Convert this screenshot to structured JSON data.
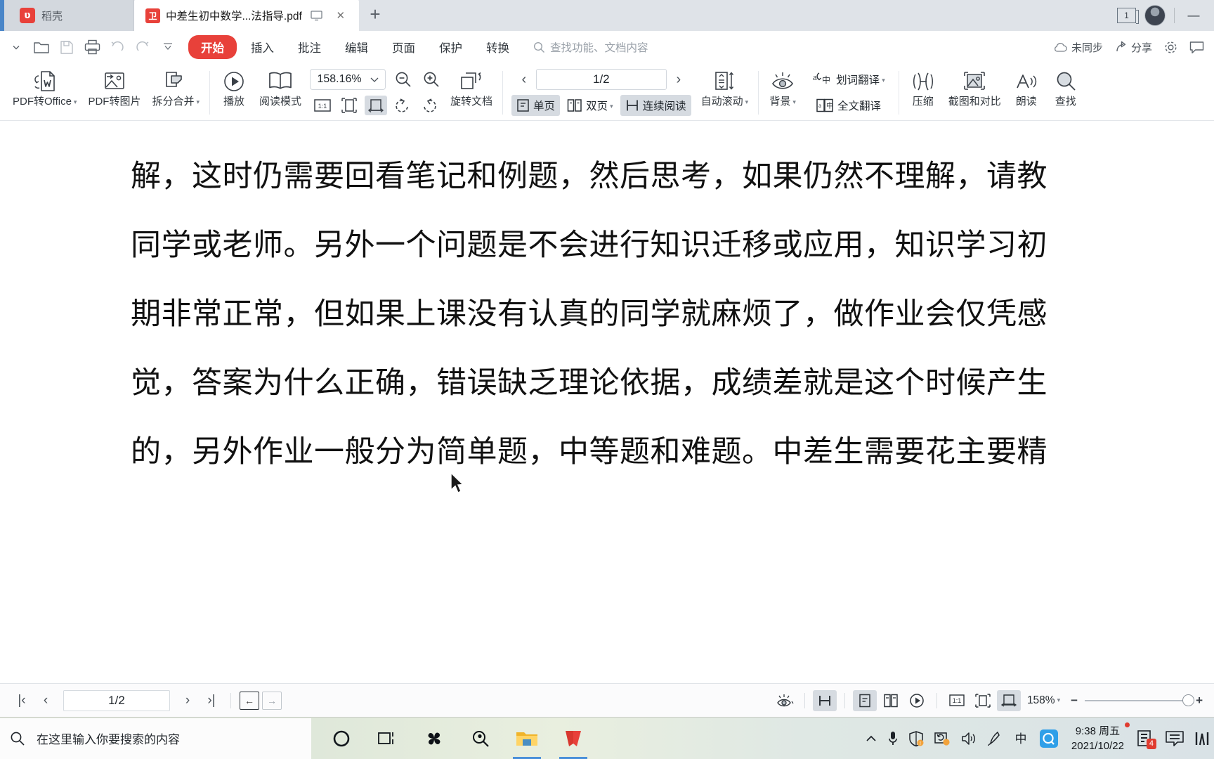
{
  "tabbar": {
    "docer_label": "稻壳",
    "docer_logo_glyph": "ʋ",
    "doc_tab_title": "中差生初中数学...法指导.pdf",
    "pdf_badge_glyph": "卫",
    "new_tab_glyph": "+",
    "close_glyph": "✕",
    "window_count": "1",
    "minimize_glyph": "—"
  },
  "menubar": {
    "quick_access": [
      {
        "name": "dropdown-more",
        "glyph": "⌄"
      },
      {
        "name": "open-file",
        "glyph": "open"
      },
      {
        "name": "save-file",
        "glyph": "save"
      },
      {
        "name": "print",
        "glyph": "print"
      },
      {
        "name": "undo",
        "glyph": "↺"
      },
      {
        "name": "redo",
        "glyph": "↻"
      },
      {
        "name": "customize",
        "glyph": "⌄"
      }
    ],
    "menus": [
      {
        "label": "开始",
        "active": true
      },
      {
        "label": "插入",
        "active": false
      },
      {
        "label": "批注",
        "active": false
      },
      {
        "label": "编辑",
        "active": false
      },
      {
        "label": "页面",
        "active": false
      },
      {
        "label": "保护",
        "active": false
      },
      {
        "label": "转换",
        "active": false
      }
    ],
    "search_placeholder": "查找功能、文档内容",
    "sync_status": "未同步",
    "share_label": "分享",
    "settings_icon": "gear-icon",
    "feedback_icon": "feedback-icon"
  },
  "ribbon": {
    "pdf_to_office": "PDF转Office",
    "pdf_to_image": "PDF转图片",
    "split_merge": "拆分合并",
    "play": "播放",
    "read_mode": "阅读模式",
    "zoom_value": "158.16%",
    "zoom_out_icon": "zoom-out-icon",
    "zoom_in_icon": "zoom-in-icon",
    "fit_actual": "1:1",
    "fit_page_icon": "fit-page-icon",
    "fit_width_icon": "fit-width-icon",
    "rotate_left_icon": "rotate-left-icon",
    "rotate_right_icon": "rotate-right-icon",
    "rotate_doc": "旋转文档",
    "page_indicator": "1/2",
    "prev_page_glyph": "‹",
    "next_page_glyph": "›",
    "single_page": "单页",
    "double_page": "双页",
    "continuous_read": "连续阅读",
    "auto_scroll": "自动滚动",
    "background": "背景",
    "word_translate": "划词翻译",
    "full_translate": "全文翻译",
    "compress": "压缩",
    "screenshot_compare": "截图和对比",
    "read_aloud": "朗读",
    "find": "查找"
  },
  "document": {
    "lines": [
      "解，这时仍需要回看笔记和例题，然后思考，如果仍然不理解，请教",
      "同学或老师。另外一个问题是不会进行知识迁移或应用，知识学习初",
      "期非常正常，但如果上课没有认真的同学就麻烦了，做作业会仅凭感",
      "觉，答案为什么正确，错误缺乏理论依据，成绩差就是这个时候产生",
      "的，另外作业一般分为简单题，中等题和难题。中差生需要花主要精"
    ]
  },
  "statusbar": {
    "first_page_glyph": "|‹",
    "prev_page_glyph": "‹",
    "page_indicator": "1/2",
    "next_page_glyph": "›",
    "last_page_glyph": "›|",
    "back_glyph": "←",
    "forward_glyph": "→",
    "eye_protect_icon": "eye-protect-icon",
    "continuous_icon": "continuous-read-icon",
    "single_page_icon": "single-page-icon",
    "double_page_icon": "double-page-icon",
    "play_icon": "play-icon",
    "actual_size": "1:1",
    "fit_page_icon": "fit-page-icon",
    "fit_width_icon": "fit-width-icon",
    "zoom_text": "158%",
    "zoom_caret": "▾",
    "minus_glyph": "−",
    "plus_glyph": "+"
  },
  "taskbar": {
    "search_placeholder": "在这里输入你要搜索的内容",
    "search_icon": "search-icon",
    "apps": [
      {
        "name": "cortana-icon"
      },
      {
        "name": "task-view-icon"
      },
      {
        "name": "app-pinwheel-icon"
      },
      {
        "name": "everything-search-icon"
      },
      {
        "name": "file-explorer-icon"
      },
      {
        "name": "wps-office-icon"
      }
    ],
    "tray": {
      "expand_glyph": "⌃",
      "mic_icon": "microphone-icon",
      "security_icon": "security-shield-icon",
      "update_icon": "update-icon",
      "volume_icon": "volume-icon",
      "pen_icon": "pen-icon",
      "ime_label": "中",
      "qq_label": "Q",
      "time": "9:38 周五",
      "date": "2021/10/22",
      "notes_badge": "4",
      "notification_icon": "notification-icon",
      "meter_icon": "meter-icon"
    }
  },
  "colors": {
    "accent_red": "#e8413a",
    "tabbar_bg": "#dfe3e8",
    "selected_gray": "#d6dbe1",
    "text_dark": "#33393f"
  }
}
